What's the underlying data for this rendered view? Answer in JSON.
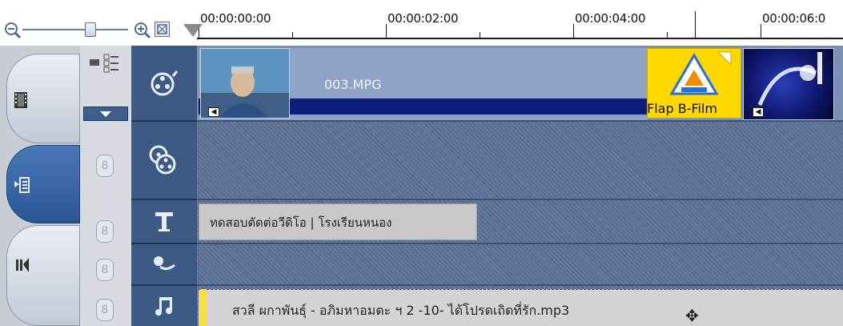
{
  "toolbar": {
    "zoom_out_icon": "zoom-out-icon",
    "zoom_in_icon": "zoom-in-icon",
    "fit_icon": "fit-to-window-icon"
  },
  "ruler": {
    "timecodes": [
      "00:00:00:00",
      "00:00:02:00",
      "00:00:04:00",
      "00:00:06:0"
    ]
  },
  "tracks": {
    "video": {
      "clip_name": "003.MPG",
      "transition_label": "Flap B-Film"
    },
    "title": {
      "text": "ทดสอบตัดต่อวีดิโอ | โรงเรียนหนอง"
    },
    "music": {
      "text": "สวลี ผกาพันธุ์ - อภิมหาอมตะ ฯ 2 -10- ได้โปรดเถิดที่รัก.mp3"
    }
  },
  "colors": {
    "track_header_bg": "#3c5a84",
    "video_track": "#7b8fb5",
    "clip_strip": "#0b1f7a",
    "transition_yellow": "#ffd800"
  }
}
